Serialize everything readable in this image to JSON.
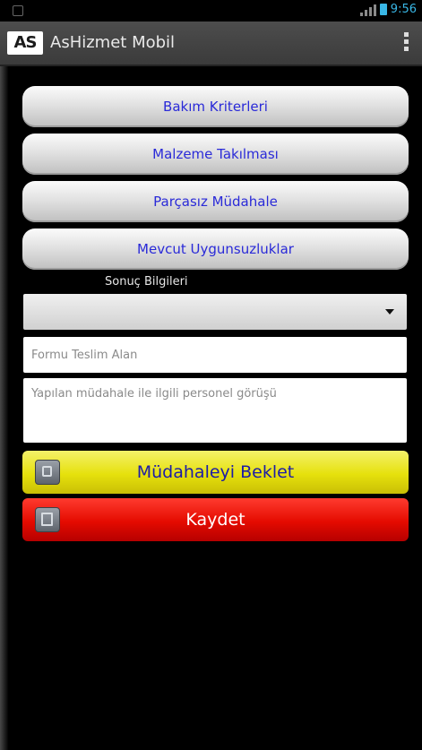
{
  "status_bar": {
    "time": "9:56"
  },
  "action_bar": {
    "logo_text": "AS",
    "title": "AsHizmet Mobil"
  },
  "menu_buttons": [
    {
      "label": "Bakım Kriterleri"
    },
    {
      "label": "Malzeme Takılması"
    },
    {
      "label": "Parçasız Müdahale"
    },
    {
      "label": "Mevcut Uygunsuzluklar"
    }
  ],
  "form": {
    "result_label": "Sonuç Bilgileri",
    "result_value": "",
    "receiver_placeholder": "Formu Teslim Alan",
    "comment_placeholder": "Yapılan müdahale ile ilgili personel görüşü"
  },
  "buttons": {
    "wait_label": "Müdahaleyi Beklet",
    "save_label": "Kaydet"
  },
  "colors": {
    "menu_text": "#2a2ad8",
    "wait_bg": "#e6e10c",
    "save_bg": "#e40b00",
    "status_accent": "#39b7e6"
  }
}
